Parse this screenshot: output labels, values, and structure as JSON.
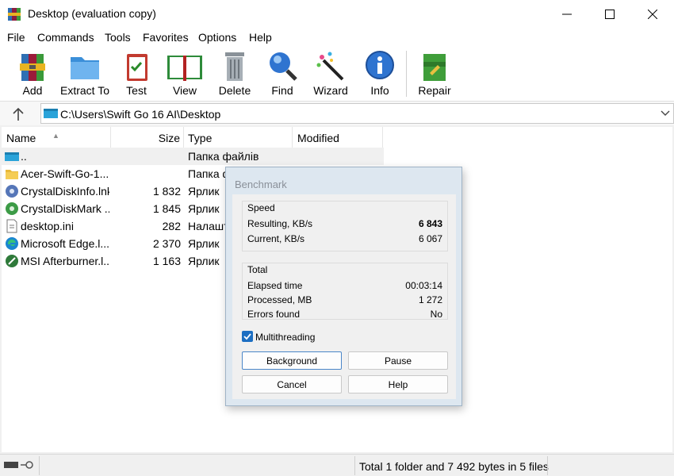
{
  "window": {
    "title": "Desktop (evaluation copy)"
  },
  "menu": [
    "File",
    "Commands",
    "Tools",
    "Favorites",
    "Options",
    "Help"
  ],
  "toolbar": {
    "add": "Add",
    "extract": "Extract To",
    "test": "Test",
    "view": "View",
    "delete": "Delete",
    "find": "Find",
    "wizard": "Wizard",
    "info": "Info",
    "repair": "Repair"
  },
  "address": {
    "path": "C:\\Users\\Swift Go 16 AI\\Desktop"
  },
  "columns": {
    "name": "Name",
    "size": "Size",
    "type": "Type",
    "modified": "Modified"
  },
  "files": [
    {
      "name": "..",
      "size": "",
      "type": "Папка файлів",
      "icon": "drive-icon"
    },
    {
      "name": "Acer-Swift-Go-1...",
      "size": "",
      "type": "Папка ф",
      "icon": "folder-icon"
    },
    {
      "name": "CrystalDiskInfo.lnk",
      "size": "1 832",
      "type": "Ярлик",
      "icon": "crystaldiskinfo-icon"
    },
    {
      "name": "CrystalDiskMark ...",
      "size": "1 845",
      "type": "Ярлик",
      "icon": "crystaldiskmark-icon"
    },
    {
      "name": "desktop.ini",
      "size": "282",
      "type": "Налашт",
      "icon": "ini-file-icon"
    },
    {
      "name": "Microsoft Edge.l...",
      "size": "2 370",
      "type": "Ярлик",
      "icon": "edge-icon"
    },
    {
      "name": "MSI Afterburner.l...",
      "size": "1 163",
      "type": "Ярлик",
      "icon": "afterburner-icon"
    }
  ],
  "status": {
    "summary": "Total 1 folder and 7 492 bytes in 5 files"
  },
  "benchmark": {
    "title": "Benchmark",
    "speed_label": "Speed",
    "resulting_label": "Resulting, KB/s",
    "resulting_value": "6 843",
    "current_label": "Current, KB/s",
    "current_value": "6 067",
    "total_label": "Total",
    "elapsed_label": "Elapsed time",
    "elapsed_value": "00:03:14",
    "processed_label": "Processed, MB",
    "processed_value": "1 272",
    "errors_label": "Errors found",
    "errors_value": "No",
    "multithreading_label": "Multithreading",
    "multithreading_checked": true,
    "buttons": {
      "background": "Background",
      "pause": "Pause",
      "cancel": "Cancel",
      "help": "Help"
    }
  }
}
